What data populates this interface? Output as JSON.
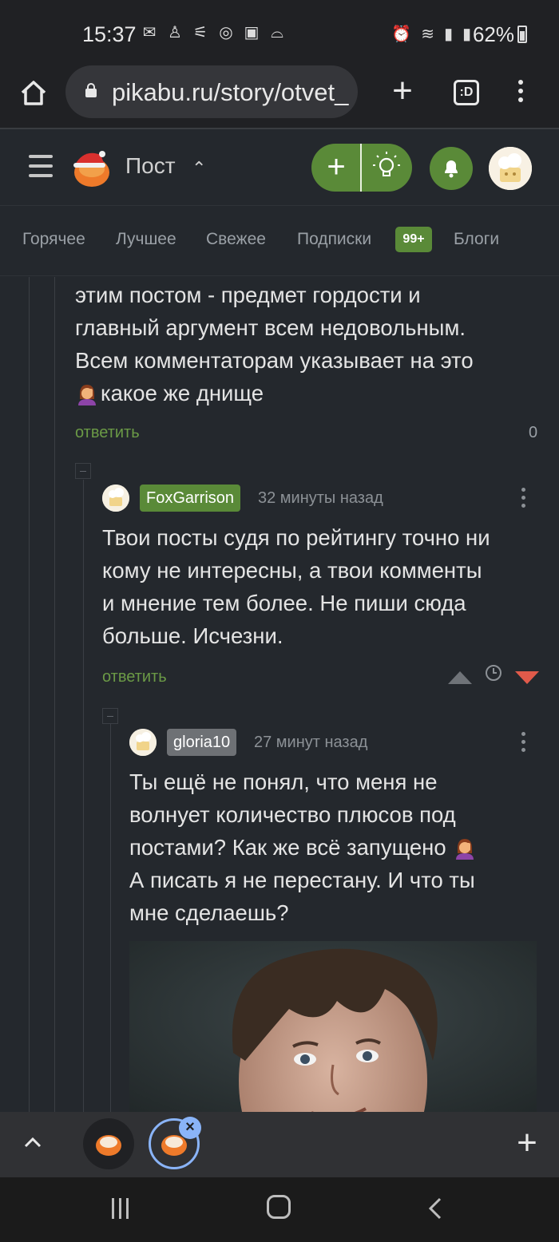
{
  "status_bar": {
    "time": "15:37",
    "battery": "62%"
  },
  "browser": {
    "url": "pikabu.ru/story/otvet_",
    "tabs_label": ":D"
  },
  "header": {
    "title": "Пост"
  },
  "nav": {
    "tabs": [
      "Горячее",
      "Лучшее",
      "Свежее",
      "Подписки",
      "Блоги"
    ],
    "subscriptions_badge": "99+"
  },
  "comments": [
    {
      "text_lines": [
        "этим постом - предмет гордости и",
        "главный аргумент всем недовольным.",
        "Всем комментаторам указывает на это",
        "какое же днище"
      ],
      "reply_label": "ответить",
      "rating": "0"
    },
    {
      "author": "FoxGarrison",
      "time": "32 минуты назад",
      "text_lines": [
        "Твои посты судя по рейтингу точно ни",
        "кому не интересны, а твои комменты",
        "и мнение тем более. Не пиши сюда",
        "больше. Исчезни."
      ],
      "reply_label": "ответить"
    },
    {
      "author": "gloria10",
      "time": "27 минут назад",
      "text_lines": [
        "Ты ещё не понял, что меня не",
        "волнует количество плюсов под",
        "постами? Как же всё запущено",
        "А писать я не перестану. И что ты",
        "мне сделаешь?"
      ]
    }
  ],
  "colors": {
    "accent": "#5a8a38",
    "background": "#24282d",
    "downvote": "#e05a4a"
  },
  "icons": [
    "home-icon",
    "lock-icon",
    "plus-icon",
    "tabs-icon",
    "more-icon",
    "hamburger-icon",
    "lightbulb-icon",
    "bell-icon",
    "chevron-up-icon",
    "close-icon"
  ]
}
